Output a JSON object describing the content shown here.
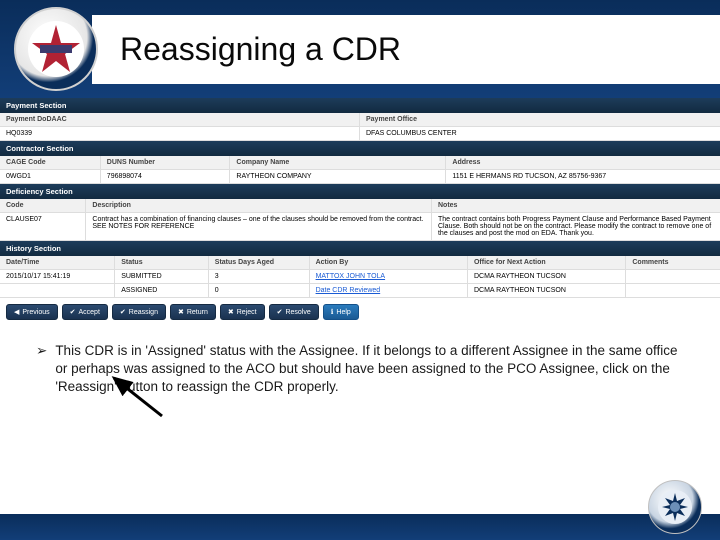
{
  "title": "Reassigning a CDR",
  "sections": {
    "payment": {
      "header": "Payment Section",
      "labels": {
        "dodaac": "Payment DoDAAC",
        "office": "Payment Office"
      },
      "values": {
        "dodaac": "HQ0339",
        "office": "DFAS COLUMBUS CENTER"
      }
    },
    "contractor": {
      "header": "Contractor Section",
      "labels": {
        "cage": "CAGE Code",
        "duns": "DUNS Number",
        "company": "Company Name",
        "address": "Address"
      },
      "values": {
        "cage": "0WGD1",
        "duns": "796898074",
        "company": "RAYTHEON COMPANY",
        "address": "1151 E HERMANS RD TUCSON, AZ 85756-9367"
      }
    },
    "deficiency": {
      "header": "Deficiency Section",
      "labels": {
        "code": "Code",
        "description": "Description",
        "notes": "Notes"
      },
      "values": {
        "code": "CLAUSE07",
        "description": "Contract has a combination of financing clauses – one of the clauses should be removed from the contract. SEE NOTES FOR REFERENCE",
        "notes": "The contract contains both Progress Payment Clause and Performance Based Payment Clause. Both should not be on the contract. Please modify the contract to remove one of the clauses and post the mod on EDA. Thank you."
      }
    },
    "history": {
      "header": "History Section",
      "labels": {
        "datetime": "Date/Time",
        "status": "Status",
        "days": "Status Days Aged",
        "by": "Action By",
        "office": "Office for Next Action",
        "comments": "Comments"
      },
      "rows": [
        {
          "datetime": "2015/10/17 15:41:19",
          "status": "SUBMITTED",
          "days": "3",
          "by": "MATTOX JOHN TOLA",
          "office": "DCMA RAYTHEON TUCSON",
          "comments": ""
        },
        {
          "datetime": "",
          "status": "ASSIGNED",
          "days": "0",
          "by": "Date CDR Reviewed",
          "office": "DCMA RAYTHEON TUCSON",
          "comments": ""
        }
      ]
    }
  },
  "buttons": {
    "previous": "Previous",
    "accept": "Accept",
    "reassign": "Reassign",
    "return": "Return",
    "reject": "Reject",
    "resolve": "Resolve",
    "help": "Help"
  },
  "bullet": "This CDR is in 'Assigned' status with the Assignee. If it belongs to a different Assignee in the same office or perhaps was assigned to the ACO but should have been assigned to the PCO Assignee, click on the 'Reassign' button to reassign the CDR properly."
}
